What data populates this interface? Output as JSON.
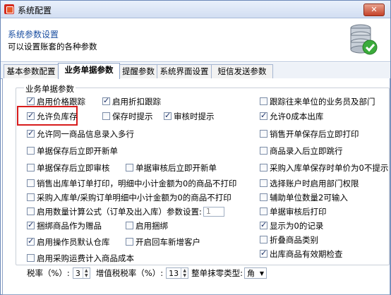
{
  "window": {
    "title": "系统配置",
    "close_label": "✕"
  },
  "header": {
    "title": "系统参数设置",
    "description": "可以设置账套的各种参数"
  },
  "tabs": [
    "基本参数配置",
    "业务单据参数",
    "提醒参数",
    "系统界面设置",
    "短信发送参数"
  ],
  "group": {
    "title": "业务单据参数"
  },
  "checkboxes": [
    {
      "label": "启用价格跟踪",
      "checked": true
    },
    {
      "label": "启用折扣跟踪",
      "checked": true
    },
    {
      "label": "跟踪往来单位的业务员及部门",
      "checked": false
    },
    {
      "label": "允许负库存",
      "checked": true
    },
    {
      "label": "保存时提示",
      "checked": false
    },
    {
      "label": "审核时提示",
      "checked": true
    },
    {
      "label": "允许0成本出库",
      "checked": true
    },
    {
      "label": "允许同一商品信息录入多行",
      "checked": true
    },
    {
      "label": "销售开单保存后立即打印",
      "checked": false
    },
    {
      "label": "单据保存后立即开新单",
      "checked": false
    },
    {
      "label": "商品录入后立即跳行",
      "checked": false
    },
    {
      "label": "单据保存后立即审核",
      "checked": false
    },
    {
      "label": "单据审核后立即开新单",
      "checked": false
    },
    {
      "label": "采购入库单保存时单价为0不提示",
      "checked": false
    },
    {
      "label": "销售出库单订单打印，明细中小计金额为0的商品不打印",
      "checked": false
    },
    {
      "label": "选择账户时启用部门权限",
      "checked": false
    },
    {
      "label": "采购入库单/采购订单明细中小计金额为0的商品不打印",
      "checked": false
    },
    {
      "label": "辅助单位数量2可输入",
      "checked": false
    },
    {
      "label": "启用数量计算公式（订单及出入库）参数设置:",
      "checked": false
    },
    {
      "label": "单据审核后打印",
      "checked": false
    },
    {
      "label": "捆绑商品作为赠品",
      "checked": true
    },
    {
      "label": "启用捆绑",
      "checked": false
    },
    {
      "label": "显示为0的记录",
      "checked": true
    },
    {
      "label": "折叠商品类别",
      "checked": false
    },
    {
      "label": "启用操作员默认仓库",
      "checked": true
    },
    {
      "label": "开启回车新增客户",
      "checked": false
    },
    {
      "label": "启用采购运费计入商品成本",
      "checked": false
    },
    {
      "label": "出库商品有效期检查",
      "checked": true
    }
  ],
  "formula_param": {
    "value": "1"
  },
  "rates": {
    "tax_label": "税率（%）:",
    "tax_value": "3",
    "vat_label": "增值税税率（%）:",
    "vat_value": "13",
    "rounding_label": "整单抹零类型:",
    "rounding_value": "角"
  }
}
